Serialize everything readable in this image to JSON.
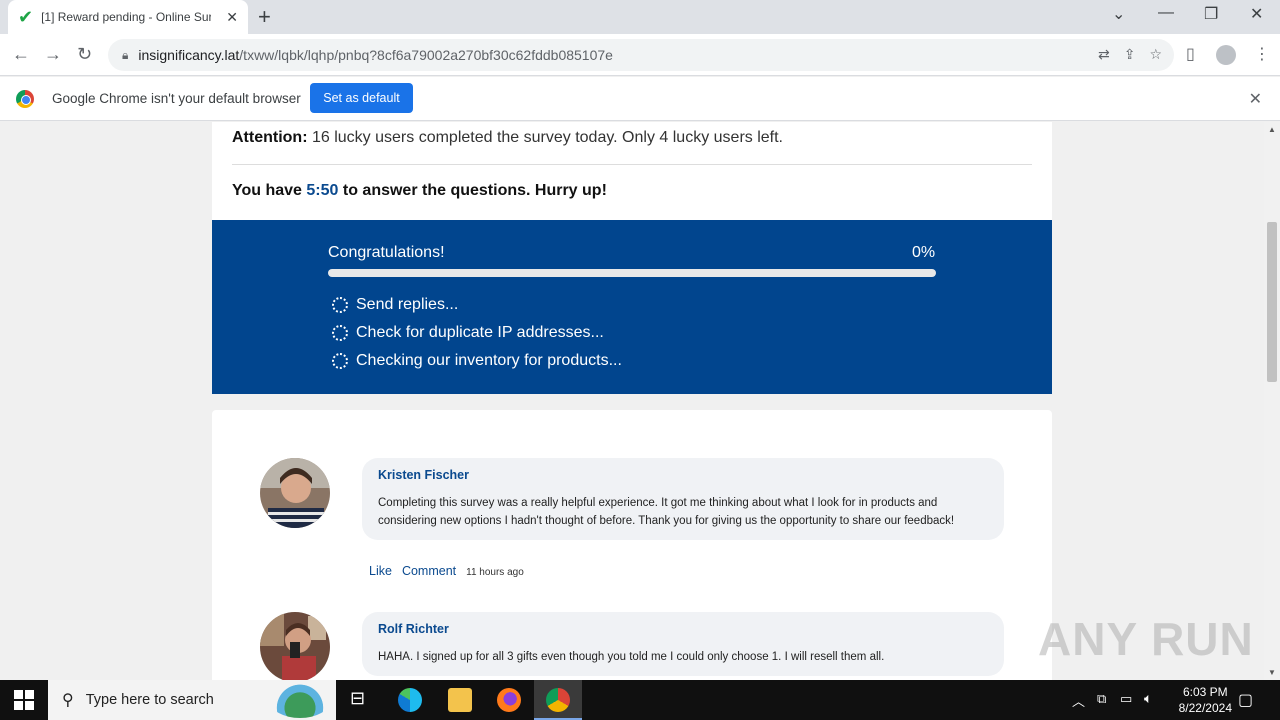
{
  "tab": {
    "title": "[1] Reward pending - Online Sur"
  },
  "address": {
    "host": "insignificancy.lat",
    "path": "/txww/lqbk/lqhp/pnbq?8cf6a79002a270bf30c62fddb085107e"
  },
  "infobar": {
    "message": "Google Chrome isn't your default browser",
    "button": "Set as default"
  },
  "page": {
    "attention_label": "Attention:",
    "attention_text": " 16 lucky users completed the survey today. Only 4 lucky users left.",
    "timer_prefix": "You have ",
    "timer_value": "5:50",
    "timer_suffix": " to answer the questions. Hurry up!",
    "progress": {
      "title": "Congratulations!",
      "percent_label": "0%",
      "percent": 0
    },
    "steps": [
      "Send replies...",
      "Check for duplicate IP addresses...",
      "Checking our inventory for products..."
    ],
    "comments": [
      {
        "name": "Kristen Fischer",
        "text": "Completing this survey was a really helpful experience. It got me thinking about what I look for in products and considering new options I hadn't thought of before. Thank you for giving us the opportunity to share our feedback!",
        "like": "Like",
        "comment": "Comment",
        "ago": "11 hours ago"
      },
      {
        "name": "Rolf Richter",
        "text": "HAHA. I signed up for all 3 gifts even though you told me I could only choose 1. I will resell them all."
      }
    ]
  },
  "watermark": "ANY RUN",
  "taskbar": {
    "search_placeholder": "Type here to search",
    "time": "6:03 PM",
    "date": "8/22/2024"
  },
  "colors": {
    "accent": "#01458e",
    "link": "#0b4a8f",
    "button": "#1a73e8"
  }
}
